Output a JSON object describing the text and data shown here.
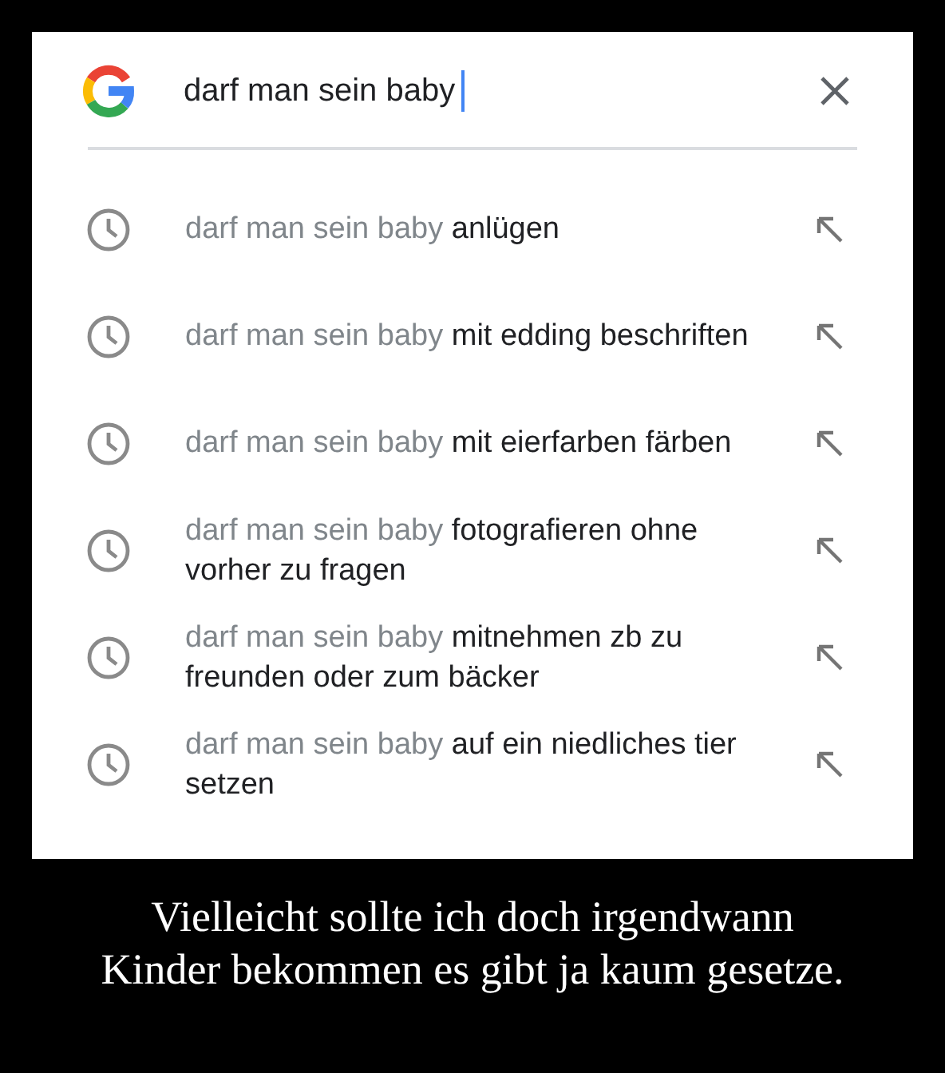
{
  "search": {
    "value": "darf man sein baby"
  },
  "suggestions": [
    {
      "text": "darf man sein baby **anlügen**"
    },
    {
      "text": "darf man sein baby **mit edding beschriften**"
    },
    {
      "text": "darf man sein baby **mit eierfarben färben**"
    },
    {
      "text": "darf man sein baby **fotografieren ohne vorher zu fragen**"
    },
    {
      "text": "darf man sein baby **mitnehmen zb zu freunden oder zum bäcker**"
    },
    {
      "text": "darf man sein baby **auf ein niedliches tier setzen**"
    }
  ],
  "caption": [
    "Vielleicht sollte ich doch irgendwann",
    "Kinder bekommen es gibt ja kaum gesetze."
  ]
}
